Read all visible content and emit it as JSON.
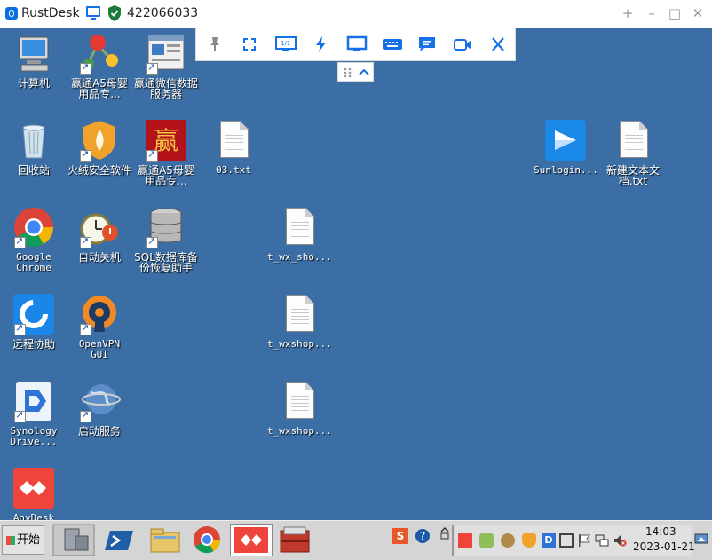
{
  "window": {
    "app_title": "RustDesk",
    "peer_id": "422066033",
    "minimize_glyph": "+",
    "collapse_glyph": "–",
    "maximize_glyph": "□",
    "close_glyph": "✕"
  },
  "toolbar": {
    "display_badge": "1/1",
    "handle_glyph": "⌃",
    "icons": [
      "pin-icon",
      "fullscreen-icon",
      "display-icon",
      "lightning-icon",
      "monitor-icon",
      "keyboard-icon",
      "chat-icon",
      "video-icon",
      "close-icon"
    ]
  },
  "desktop": {
    "icons": [
      {
        "label": "计算机"
      },
      {
        "label": "赢通A5母婴用品专..."
      },
      {
        "label": "赢通微信数据服务器"
      },
      {
        "label": "回收站"
      },
      {
        "label": "火绒安全软件"
      },
      {
        "label": "赢通A5母婴用品专..."
      },
      {
        "label": "03.txt"
      },
      {
        "label": "Sunlogin..."
      },
      {
        "label": "新建文本文档.txt"
      },
      {
        "label": "Google Chrome"
      },
      {
        "label": "自动关机"
      },
      {
        "label": "SQL数据库备份恢复助手"
      },
      {
        "label": "t_wx_sho..."
      },
      {
        "label": "远程协助"
      },
      {
        "label": "OpenVPN GUI"
      },
      {
        "label": "t_wxshop..."
      },
      {
        "label": "Synology Drive..."
      },
      {
        "label": "启动服务"
      },
      {
        "label": "t_wxshop..."
      },
      {
        "label": "AnyDesk"
      }
    ],
    "icon_art_text": "赢"
  },
  "taskbar": {
    "start_label": "开始",
    "clock_time": "14:03",
    "clock_date": "2023-01-21"
  }
}
